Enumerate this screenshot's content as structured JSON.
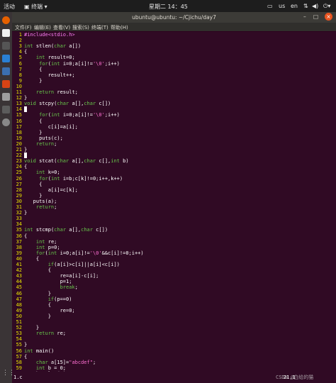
{
  "topbar": {
    "activities": "活动",
    "app_name": "终端",
    "clock": "星期二 14：45",
    "input_method": "en"
  },
  "window": {
    "title": "ubuntu@ubuntu: ~/Cjichu/day7",
    "menus": [
      "文件(F)",
      "编辑(E)",
      "查看(V)",
      "搜索(S)",
      "终端(T)",
      "帮助(H)"
    ]
  },
  "editor": {
    "lines": [
      "#include<stdio.h>",
      "",
      "int stlen(char a[])",
      "{",
      "    int result=0;",
      "     for(int i=0;a[i]!='\\0';i++)",
      "     {",
      "        result++;",
      "     }",
      "",
      "    return result;",
      "}",
      "void stcpy(char a[],char c[])",
      "{",
      "     for(int i=0;a[i]!='\\0';i++)",
      "     {",
      "        c[i]=a[i];",
      "     }",
      "     puts(c);",
      "    return;",
      "}",
      "",
      "void stcat(char a[],char c[],int b)",
      "{",
      "    int k=0;",
      "     for(int i=b;c[k]!=0;i++,k++)",
      "     {",
      "        a[i]=c[k];",
      "     }",
      "   puts(a);",
      "    return;",
      "}",
      "",
      "",
      "int stcmp(char a[],char c[])",
      "{",
      "    int re;",
      "    int p=0;",
      "    for(int i=0;a[i]!='\\0'&&c[i]!=0;i++)",
      "    {",
      "        if(a[i]>c[i]||a[i]<c[i])",
      "        {",
      "            re=a[i]-c[i];",
      "            p=1;",
      "            break;",
      "        }",
      "        if(p==0)",
      "        {",
      "            re=0;",
      "        }",
      "",
      "    }",
      "    return re;",
      "",
      "}",
      "int main()",
      "{",
      "    char a[15]=\"abcdef\";",
      "    int b = 0;",
      "    b=stlen(a);"
    ]
  },
  "status": {
    "filename": "1.c",
    "position": "21,1",
    "watermark": "CSDN @白给的猫"
  }
}
